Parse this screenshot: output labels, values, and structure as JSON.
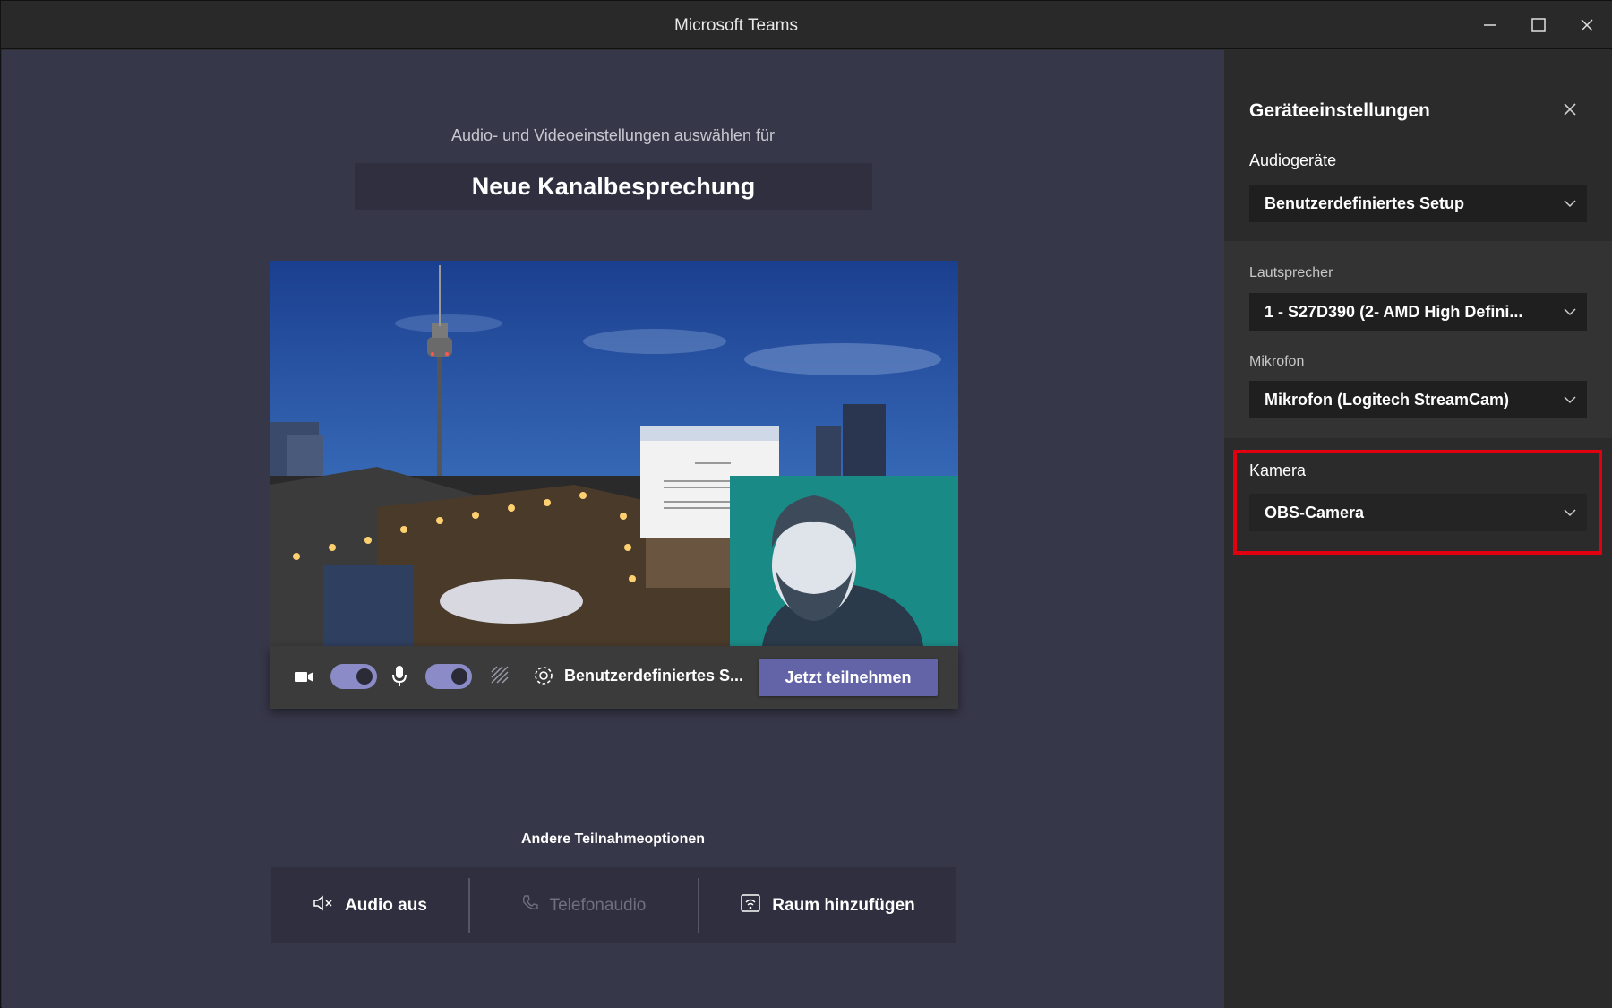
{
  "window": {
    "title": "Microsoft Teams"
  },
  "main": {
    "subtitle": "Audio- und Videoeinstellungen auswählen für",
    "meeting_name": "Neue Kanalbesprechung",
    "toolbar": {
      "camera_on": true,
      "mic_on": true,
      "device_label": "Benutzerdefiniertes S...",
      "join_label": "Jetzt teilnehmen"
    },
    "other_options": {
      "title": "Andere Teilnahmeoptionen",
      "audio_off": "Audio aus",
      "phone_audio": "Telefonaudio",
      "add_room": "Raum hinzufügen"
    }
  },
  "device_settings": {
    "title": "Geräteeinstellungen",
    "audio_devices_label": "Audiogeräte",
    "audio_devices_value": "Benutzerdefiniertes Setup",
    "speaker_label": "Lautsprecher",
    "speaker_value": "1 - S27D390 (2- AMD High Defini...",
    "mic_label": "Mikrofon",
    "mic_value": "Mikrofon (Logitech StreamCam)",
    "camera_label": "Kamera",
    "camera_value": "OBS-Camera"
  },
  "colors": {
    "accent": "#6264a7",
    "highlight": "#e0000f",
    "main_bg": "#37374a",
    "panel_bg": "#2b2b2b"
  }
}
